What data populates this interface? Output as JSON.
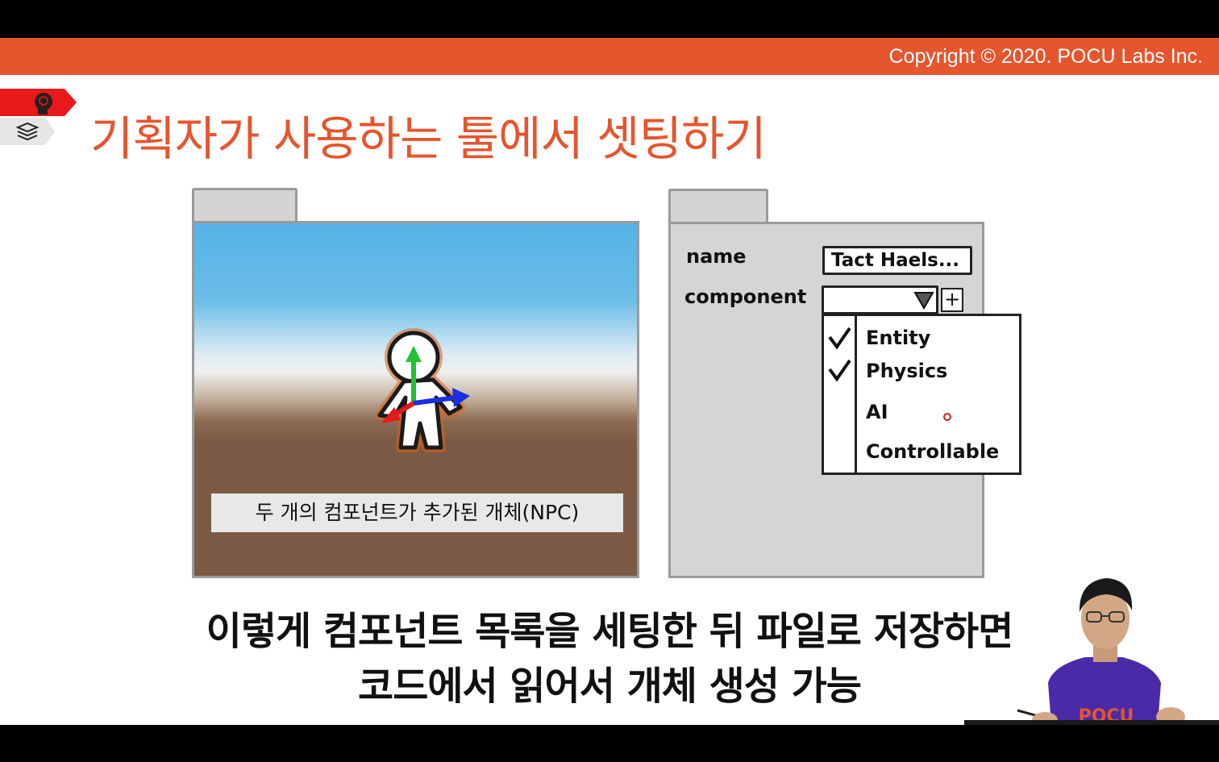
{
  "header": {
    "copyright": "Copyright © 2020. POCU Labs Inc.",
    "accent_color": "#e5552e"
  },
  "slide": {
    "title": "기획자가 사용하는 툴에서 셋팅하기",
    "icons": [
      "brain-head-icon",
      "book-stack-icon"
    ]
  },
  "scene": {
    "caption": "두 개의 컴포넌트가 추가된 개체(NPC)"
  },
  "inspector": {
    "name_label": "name",
    "name_value": "Tact Haels...",
    "component_label": "component",
    "add_button": "+",
    "options": [
      {
        "label": "Entity",
        "checked": true
      },
      {
        "label": "Physics",
        "checked": true
      },
      {
        "label": "AI",
        "checked": false
      },
      {
        "label": "Controllable",
        "checked": false
      }
    ]
  },
  "subtitles": {
    "line1": "이렇게 컴포넌트 목록을 세팅한 뒤 파일로 저장하면",
    "line2": "코드에서 읽어서 개체 생성 가능"
  },
  "presenter": {
    "shirt_text": "POCU"
  }
}
